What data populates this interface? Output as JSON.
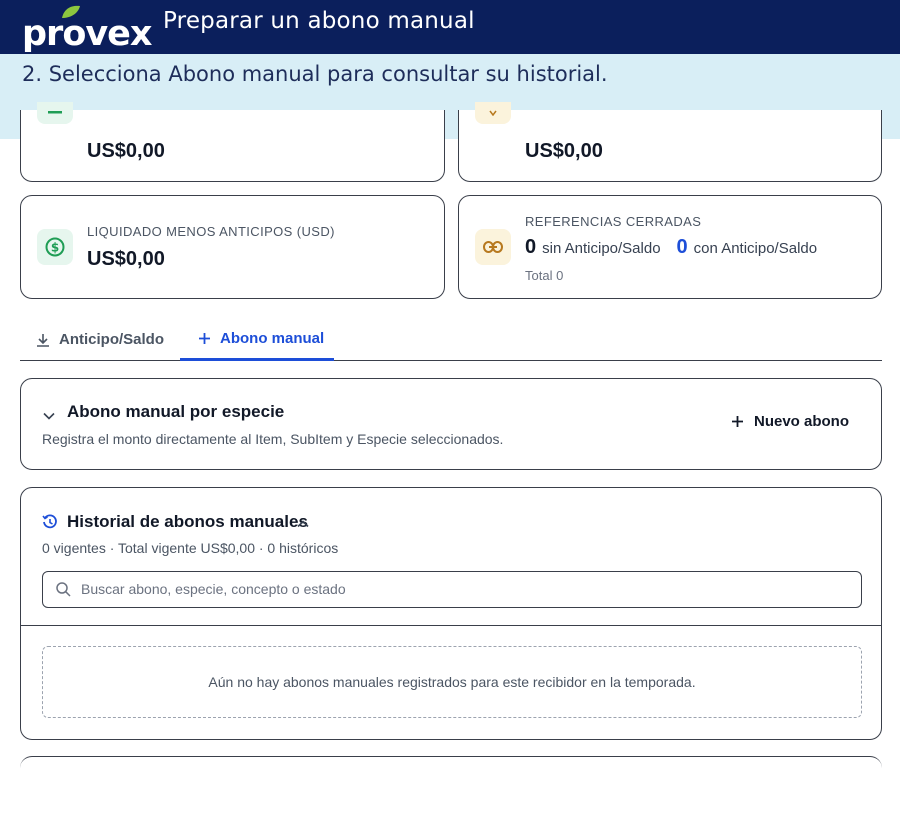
{
  "header": {
    "logo_text": "provex",
    "title": "Preparar un abono manual"
  },
  "banner": {
    "instruction": "2. Selecciona Abono manual para consultar su historial."
  },
  "kpis": {
    "top_left_amount": "US$0,00",
    "top_right_amount": "US$0,00",
    "liquidado_label": "LIQUIDADO MENOS ANTICIPOS (USD)",
    "liquidado_amount": "US$0,00",
    "referencias_label": "REFERENCIAS CERRADAS",
    "sin_count": "0",
    "sin_label": "sin Anticipo/Saldo",
    "con_count": "0",
    "con_label": "con Anticipo/Saldo",
    "total": "Total 0"
  },
  "tabs": [
    {
      "label": "Anticipo/Saldo",
      "active": false
    },
    {
      "label": "Abono manual",
      "active": true
    }
  ],
  "form": {
    "title": "Abono manual por especie",
    "subtitle": "Registra el monto directamente al Item, SubItem y Especie seleccionados.",
    "new_button": "Nuevo abono"
  },
  "history": {
    "title": "Historial de abonos manuales",
    "summary": "0 vigentes · Total vigente US$0,00 · 0 históricos",
    "search_placeholder": "Buscar abono, especie, concepto o estado",
    "empty_message": "Aún no hay abonos manuales registrados para este recibidor en la temporada."
  },
  "colors": {
    "header_bg": "#0b1f5c",
    "banner_bg": "#d8eef6",
    "accent_blue": "#1d4ed8",
    "logo_leaf": "#8cc63f"
  }
}
